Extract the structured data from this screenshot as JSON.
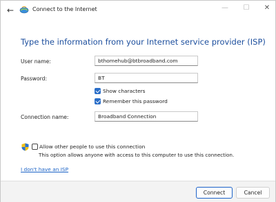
{
  "window": {
    "title": "Connect to the Internet",
    "controls": {
      "minimize": "—",
      "maximize": "☐",
      "close": "✕"
    }
  },
  "heading": "Type the information from your Internet service provider (ISP)",
  "form": {
    "user_name": {
      "label": "User name:",
      "value": "bthomehub@btbroadband.com"
    },
    "password": {
      "label": "Password:",
      "value": "BT"
    },
    "show_characters": {
      "label": "Show characters",
      "checked": true
    },
    "remember_password": {
      "label": "Remember this password",
      "checked": true
    },
    "connection_name": {
      "label": "Connection name:",
      "value": "Broadband Connection"
    },
    "allow_others": {
      "label": "Allow other people to use this connection",
      "checked": false,
      "note": "This option allows anyone with access to this computer to use this connection."
    }
  },
  "link": "I don't have an ISP",
  "buttons": {
    "connect": "Connect",
    "cancel": "Cancel"
  },
  "icons": {
    "back": "back-arrow-icon",
    "app": "network-globe-icon",
    "shield": "uac-shield-icon"
  },
  "colors": {
    "heading": "#1c4e9d",
    "accent": "#2a6ec8",
    "link": "#1a62c6"
  }
}
